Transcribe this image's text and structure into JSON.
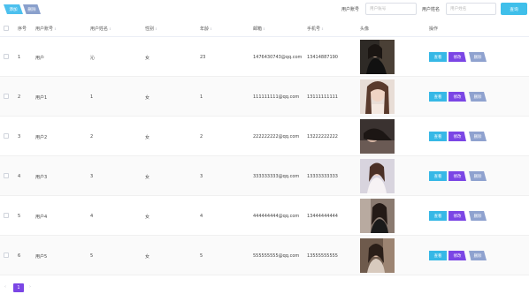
{
  "toolbar": {
    "add_label": "添加",
    "delete_label": "删除"
  },
  "search": {
    "account_label": "用户账号",
    "account_placeholder": "用户账号",
    "name_label": "用户姓名",
    "name_placeholder": "用户姓名",
    "button_label": "查询"
  },
  "table": {
    "columns": {
      "index": "序号",
      "account": "用户账号",
      "name": "用户姓名",
      "gender": "性别",
      "age": "年龄",
      "email": "邮箱",
      "phone": "手机号",
      "avatar": "头像",
      "actions": "操作"
    },
    "actions": {
      "view": "查看",
      "edit": "修改",
      "delete": "删除"
    },
    "rows": [
      {
        "index": "1",
        "account": "用户",
        "name": "沁",
        "gender": "女",
        "age": "23",
        "email": "1476430743@qq.com",
        "phone": "13414887190"
      },
      {
        "index": "2",
        "account": "用户1",
        "name": "1",
        "gender": "女",
        "age": "1",
        "email": "111111111@qq.com",
        "phone": "13111111111"
      },
      {
        "index": "3",
        "account": "用户2",
        "name": "2",
        "gender": "女",
        "age": "2",
        "email": "222222222@qq.com",
        "phone": "13222222222"
      },
      {
        "index": "4",
        "account": "用户3",
        "name": "3",
        "gender": "女",
        "age": "3",
        "email": "333333333@qq.com",
        "phone": "13333333333"
      },
      {
        "index": "5",
        "account": "用户4",
        "name": "4",
        "gender": "女",
        "age": "4",
        "email": "444444444@qq.com",
        "phone": "13444444444"
      },
      {
        "index": "6",
        "account": "用户5",
        "name": "5",
        "gender": "女",
        "age": "5",
        "email": "555555555@qq.com",
        "phone": "13555555555"
      }
    ]
  },
  "pagination": {
    "prev_icon": "chevron-left-icon",
    "current_page": "1",
    "next_icon": "chevron-right-icon"
  },
  "colors": {
    "primary": "#3fbfea",
    "edit": "#7b46e5",
    "delete": "#8fa2cf",
    "page_active": "#7b46e5"
  }
}
